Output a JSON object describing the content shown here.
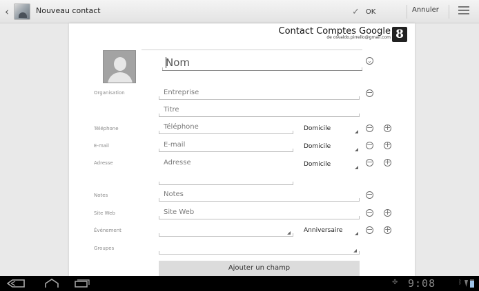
{
  "actionbar": {
    "title": "Nouveau contact",
    "ok_label": "OK",
    "cancel_label": "Annuler"
  },
  "account": {
    "name": "Contact Comptes Google",
    "email": "de osvaldo.pirrello@gmail.com",
    "logo_letter": "8"
  },
  "form": {
    "name_placeholder": "Nom",
    "labels": {
      "organisation": "Organisation",
      "telephone": "Téléphone",
      "email": "E-mail",
      "adresse": "Adresse",
      "notes": "Notes",
      "site_web": "Site Web",
      "evenement": "Événement",
      "groupes": "Groupes"
    },
    "fields": {
      "entreprise": "Entreprise",
      "titre": "Titre",
      "telephone": "Téléphone",
      "email": "E-mail",
      "adresse": "Adresse",
      "notes": "Notes",
      "site_web": "Site Web"
    },
    "types": {
      "telephone": "Domicile",
      "email": "Domicile",
      "adresse": "Domicile",
      "evenement": "Anniversaire"
    },
    "add_field_label": "Ajouter un champ"
  },
  "systembar": {
    "time": "9:08"
  },
  "colors": {
    "background": "#e9e9e9",
    "sheet": "#ffffff",
    "systembar": "#000000"
  }
}
